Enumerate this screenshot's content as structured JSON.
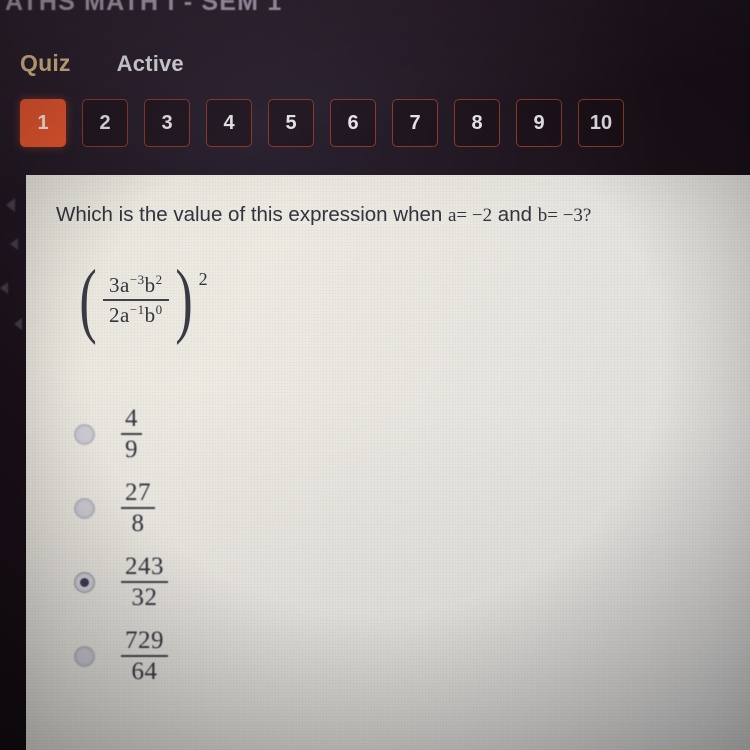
{
  "course": {
    "title_partial": "ATHS MATH I - SEM 1"
  },
  "header": {
    "quiz_label": "Quiz",
    "status_label": "Active",
    "question_numbers": [
      "1",
      "2",
      "3",
      "4",
      "5",
      "6",
      "7",
      "8",
      "9",
      "10"
    ],
    "active_question": "1",
    "accent_color": "#e1552f",
    "quiz_label_color": "#d8b98a",
    "border_color": "#8a3a26"
  },
  "question": {
    "prompt_prefix": "Which is the value of this expression when ",
    "var_a": "a",
    "eq1": "= ",
    "val_a": "−2",
    "conjunction": " and ",
    "var_b": "b",
    "eq2": "= ",
    "val_b": "−3",
    "terminator": "?",
    "expression": {
      "numerator_coeff": "3",
      "numerator": "3a⁻³b²",
      "denominator": "2a⁻¹b⁰",
      "num_base1": "3a",
      "num_exp1": "−3",
      "num_base2": "b",
      "num_exp2": "2",
      "den_base1": "2a",
      "den_exp1": "−1",
      "den_base2": "b",
      "den_exp2": "0",
      "outer_exponent": "2",
      "open_paren": "(",
      "close_paren": ")"
    }
  },
  "options": [
    {
      "numerator": "4",
      "denominator": "9",
      "selected": false
    },
    {
      "numerator": "27",
      "denominator": "8",
      "selected": false
    },
    {
      "numerator": "243",
      "denominator": "32",
      "selected": true
    },
    {
      "numerator": "729",
      "denominator": "64",
      "selected": false
    }
  ]
}
